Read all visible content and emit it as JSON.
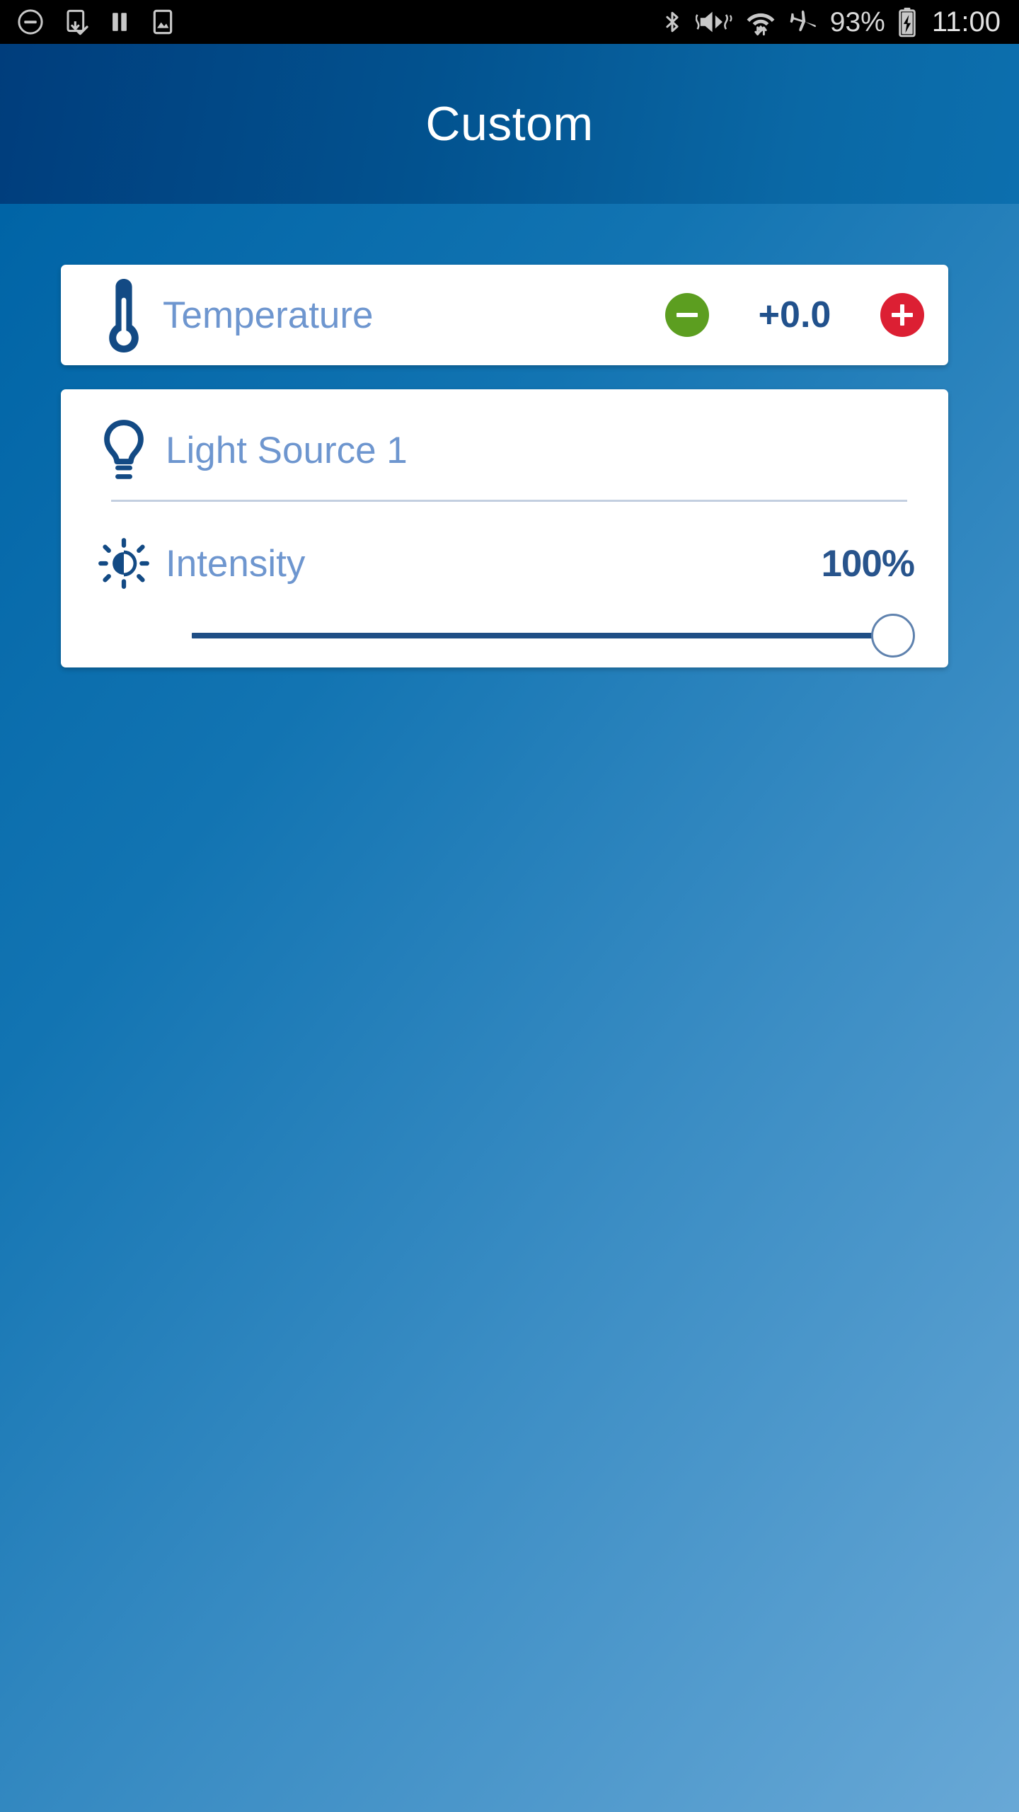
{
  "status_bar": {
    "left_icons": [
      {
        "name": "do-not-disturb-icon",
        "label": "Do not disturb"
      },
      {
        "name": "download-complete-icon",
        "label": "Download complete"
      },
      {
        "name": "pause-icon",
        "label": "Paused"
      },
      {
        "name": "screenshot-icon",
        "label": "Screenshot"
      }
    ],
    "right_icons": [
      {
        "name": "bluetooth-icon",
        "label": "Bluetooth"
      },
      {
        "name": "volume-mute-vibrate-icon",
        "label": "Silent vibrate"
      },
      {
        "name": "wifi-icon",
        "label": "Wi-Fi with data transfer"
      },
      {
        "name": "airplane-mode-icon",
        "label": "Airplane mode"
      }
    ],
    "battery_percent": "93%",
    "battery_icon": "battery-charging-icon",
    "clock": "11:00"
  },
  "app_bar": {
    "title": "Custom"
  },
  "colors": {
    "app_bar_start": "#003d7c",
    "app_bar_end": "#0c6fae",
    "page_bg_start": "#0064a6",
    "page_bg_end": "#68a8d6",
    "card_bg": "#ffffff",
    "label_blue": "#6e96cf",
    "value_blue": "#28548c",
    "icon_blue": "#134a84",
    "minus_green": "#5c9e20",
    "plus_red": "#dc1f33",
    "divider": "#c3cfe0",
    "slider_track": "#1f4e85",
    "slider_thumb_border": "#5f82ae"
  },
  "cards": {
    "temperature": {
      "icon": "thermometer-icon",
      "label": "Temperature",
      "minus_label": "−",
      "value": "+0.0",
      "plus_label": "+"
    },
    "light_source": {
      "icon": "lightbulb-icon",
      "label": "Light Source 1",
      "intensity": {
        "icon": "brightness-icon",
        "label": "Intensity",
        "value": "100%",
        "slider_percent": 100,
        "slider_min": 0,
        "slider_max": 100
      }
    }
  }
}
